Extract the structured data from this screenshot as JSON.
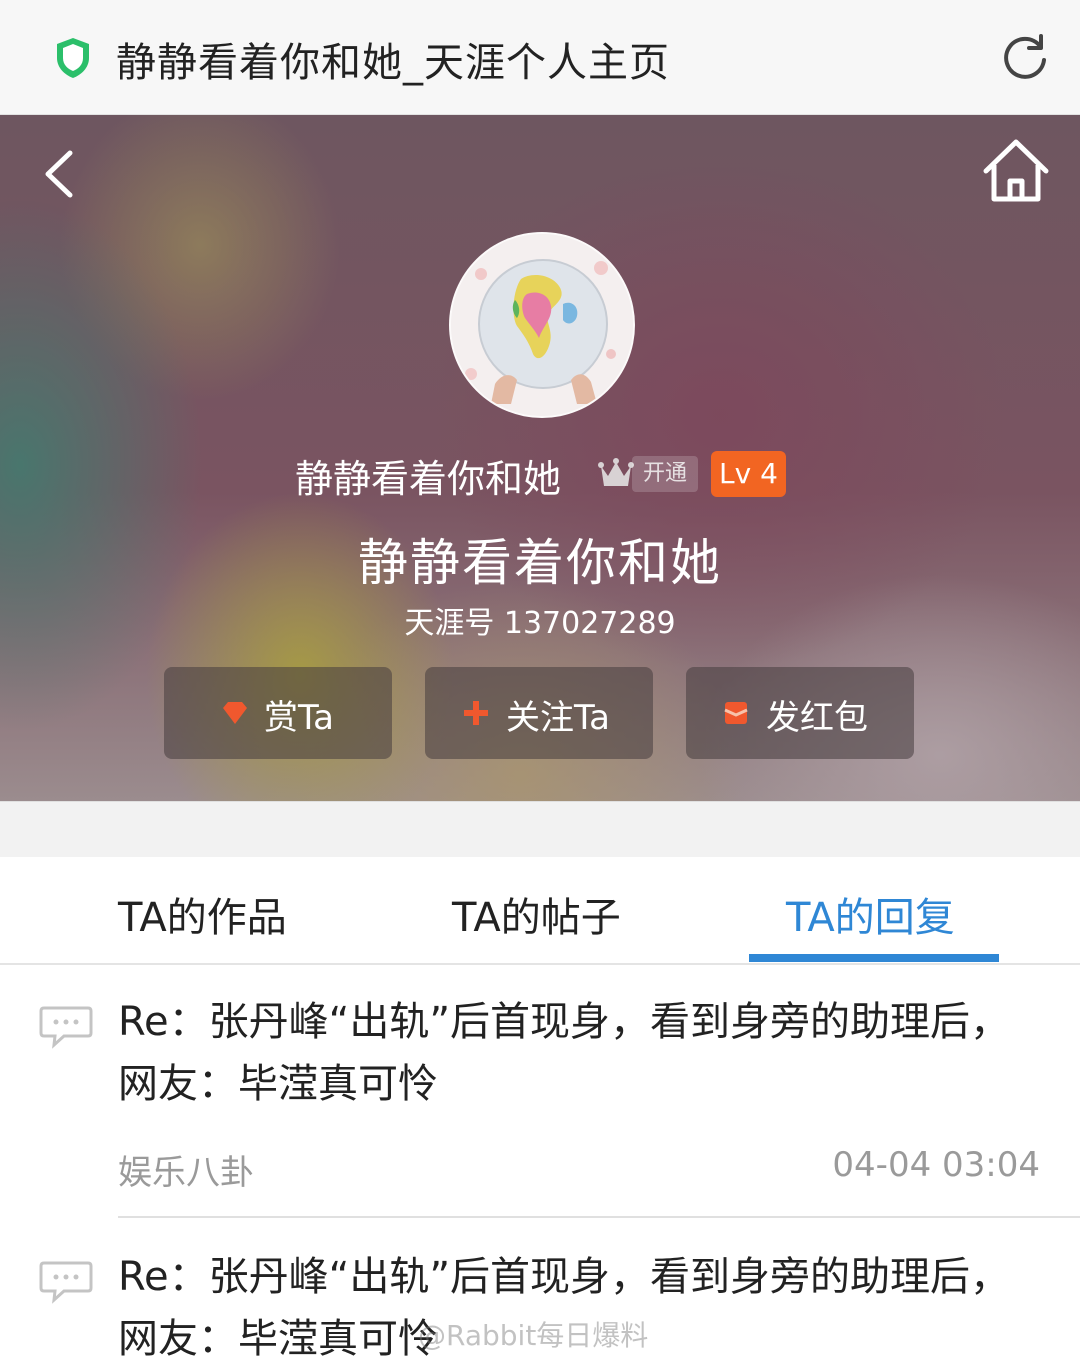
{
  "browser": {
    "title": "静静看着你和她_天涯个人主页",
    "shield_icon": "shield-icon",
    "refresh_icon": "refresh-icon"
  },
  "profile": {
    "display_name": "静静看着你和她",
    "vip_label": "开通",
    "level": "Lv 4",
    "big_name": "静静看着你和她",
    "tianya_id": "天涯号 137027289",
    "actions": [
      {
        "label": "赏Ta",
        "icon": "diamond-icon"
      },
      {
        "label": "关注Ta",
        "icon": "plus-icon"
      },
      {
        "label": "发红包",
        "icon": "red-packet-icon"
      }
    ]
  },
  "tabs": [
    {
      "label": "TA的作品",
      "active": false
    },
    {
      "label": "TA的帖子",
      "active": false
    },
    {
      "label": "TA的回复",
      "active": true
    }
  ],
  "replies": [
    {
      "title": "Re：张丹峰“出轨”后首现身，看到身旁的助理后，网友：毕滢真可怜",
      "category": "娱乐八卦",
      "time": "04-04 03:04"
    },
    {
      "title": "Re：张丹峰“出轨”后首现身，看到身旁的助理后，网友：毕滢真可怜",
      "category": "",
      "time": ""
    }
  ],
  "watermark": "@Rabbit每日爆料",
  "colors": {
    "accent_blue": "#2f87d5",
    "level_orange": "#f26522",
    "shield_green": "#2bbf6a"
  }
}
